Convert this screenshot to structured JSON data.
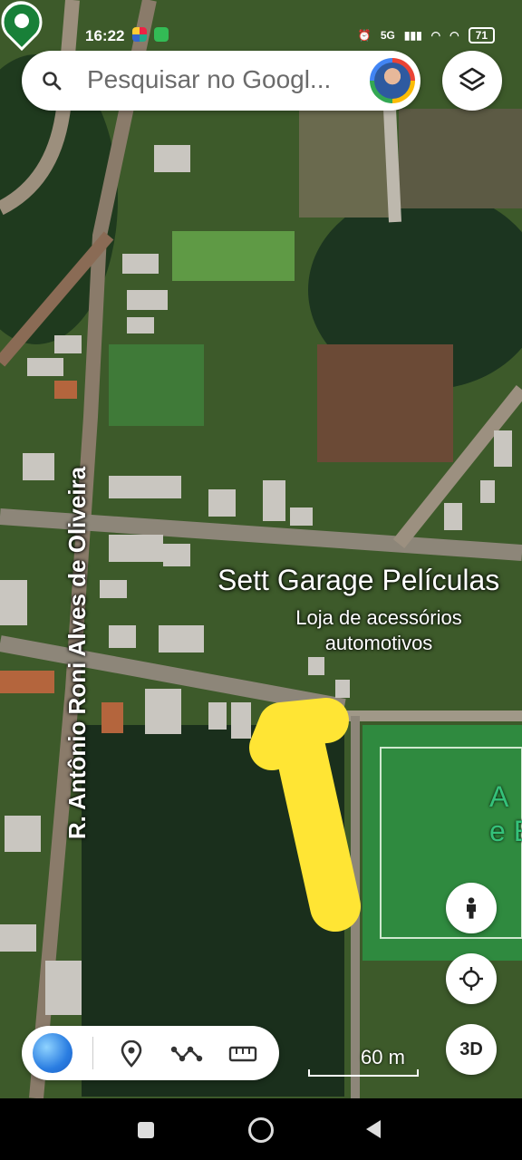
{
  "status_bar": {
    "time": "16:22",
    "network": "5G",
    "battery": "71"
  },
  "search": {
    "placeholder": "Pesquisar no Googl..."
  },
  "map": {
    "poi": {
      "name": "Sett Garage Películas",
      "category_line1": "Loja de acessórios",
      "category_line2": "automotivos",
      "icon": "shopping-bag-icon",
      "pin_color": "#1a73e8"
    },
    "street_label": "R. Antônio Roni Alves de Oliveira",
    "park_label_line1": "A",
    "park_label_line2": "e E",
    "park_pin_color": "#188038",
    "annotation_color": "#ffe534"
  },
  "controls": {
    "layers_icon": "layers-icon",
    "pegman_icon": "pegman-icon",
    "location_icon": "my-location-icon",
    "three_d_label": "3D"
  },
  "bottom_bar": {
    "earth_icon": "earth-icon",
    "pin_icon": "location-pin-icon",
    "path_icon": "path-icon",
    "measure_icon": "ruler-icon"
  },
  "scale": {
    "label": "60 m"
  }
}
